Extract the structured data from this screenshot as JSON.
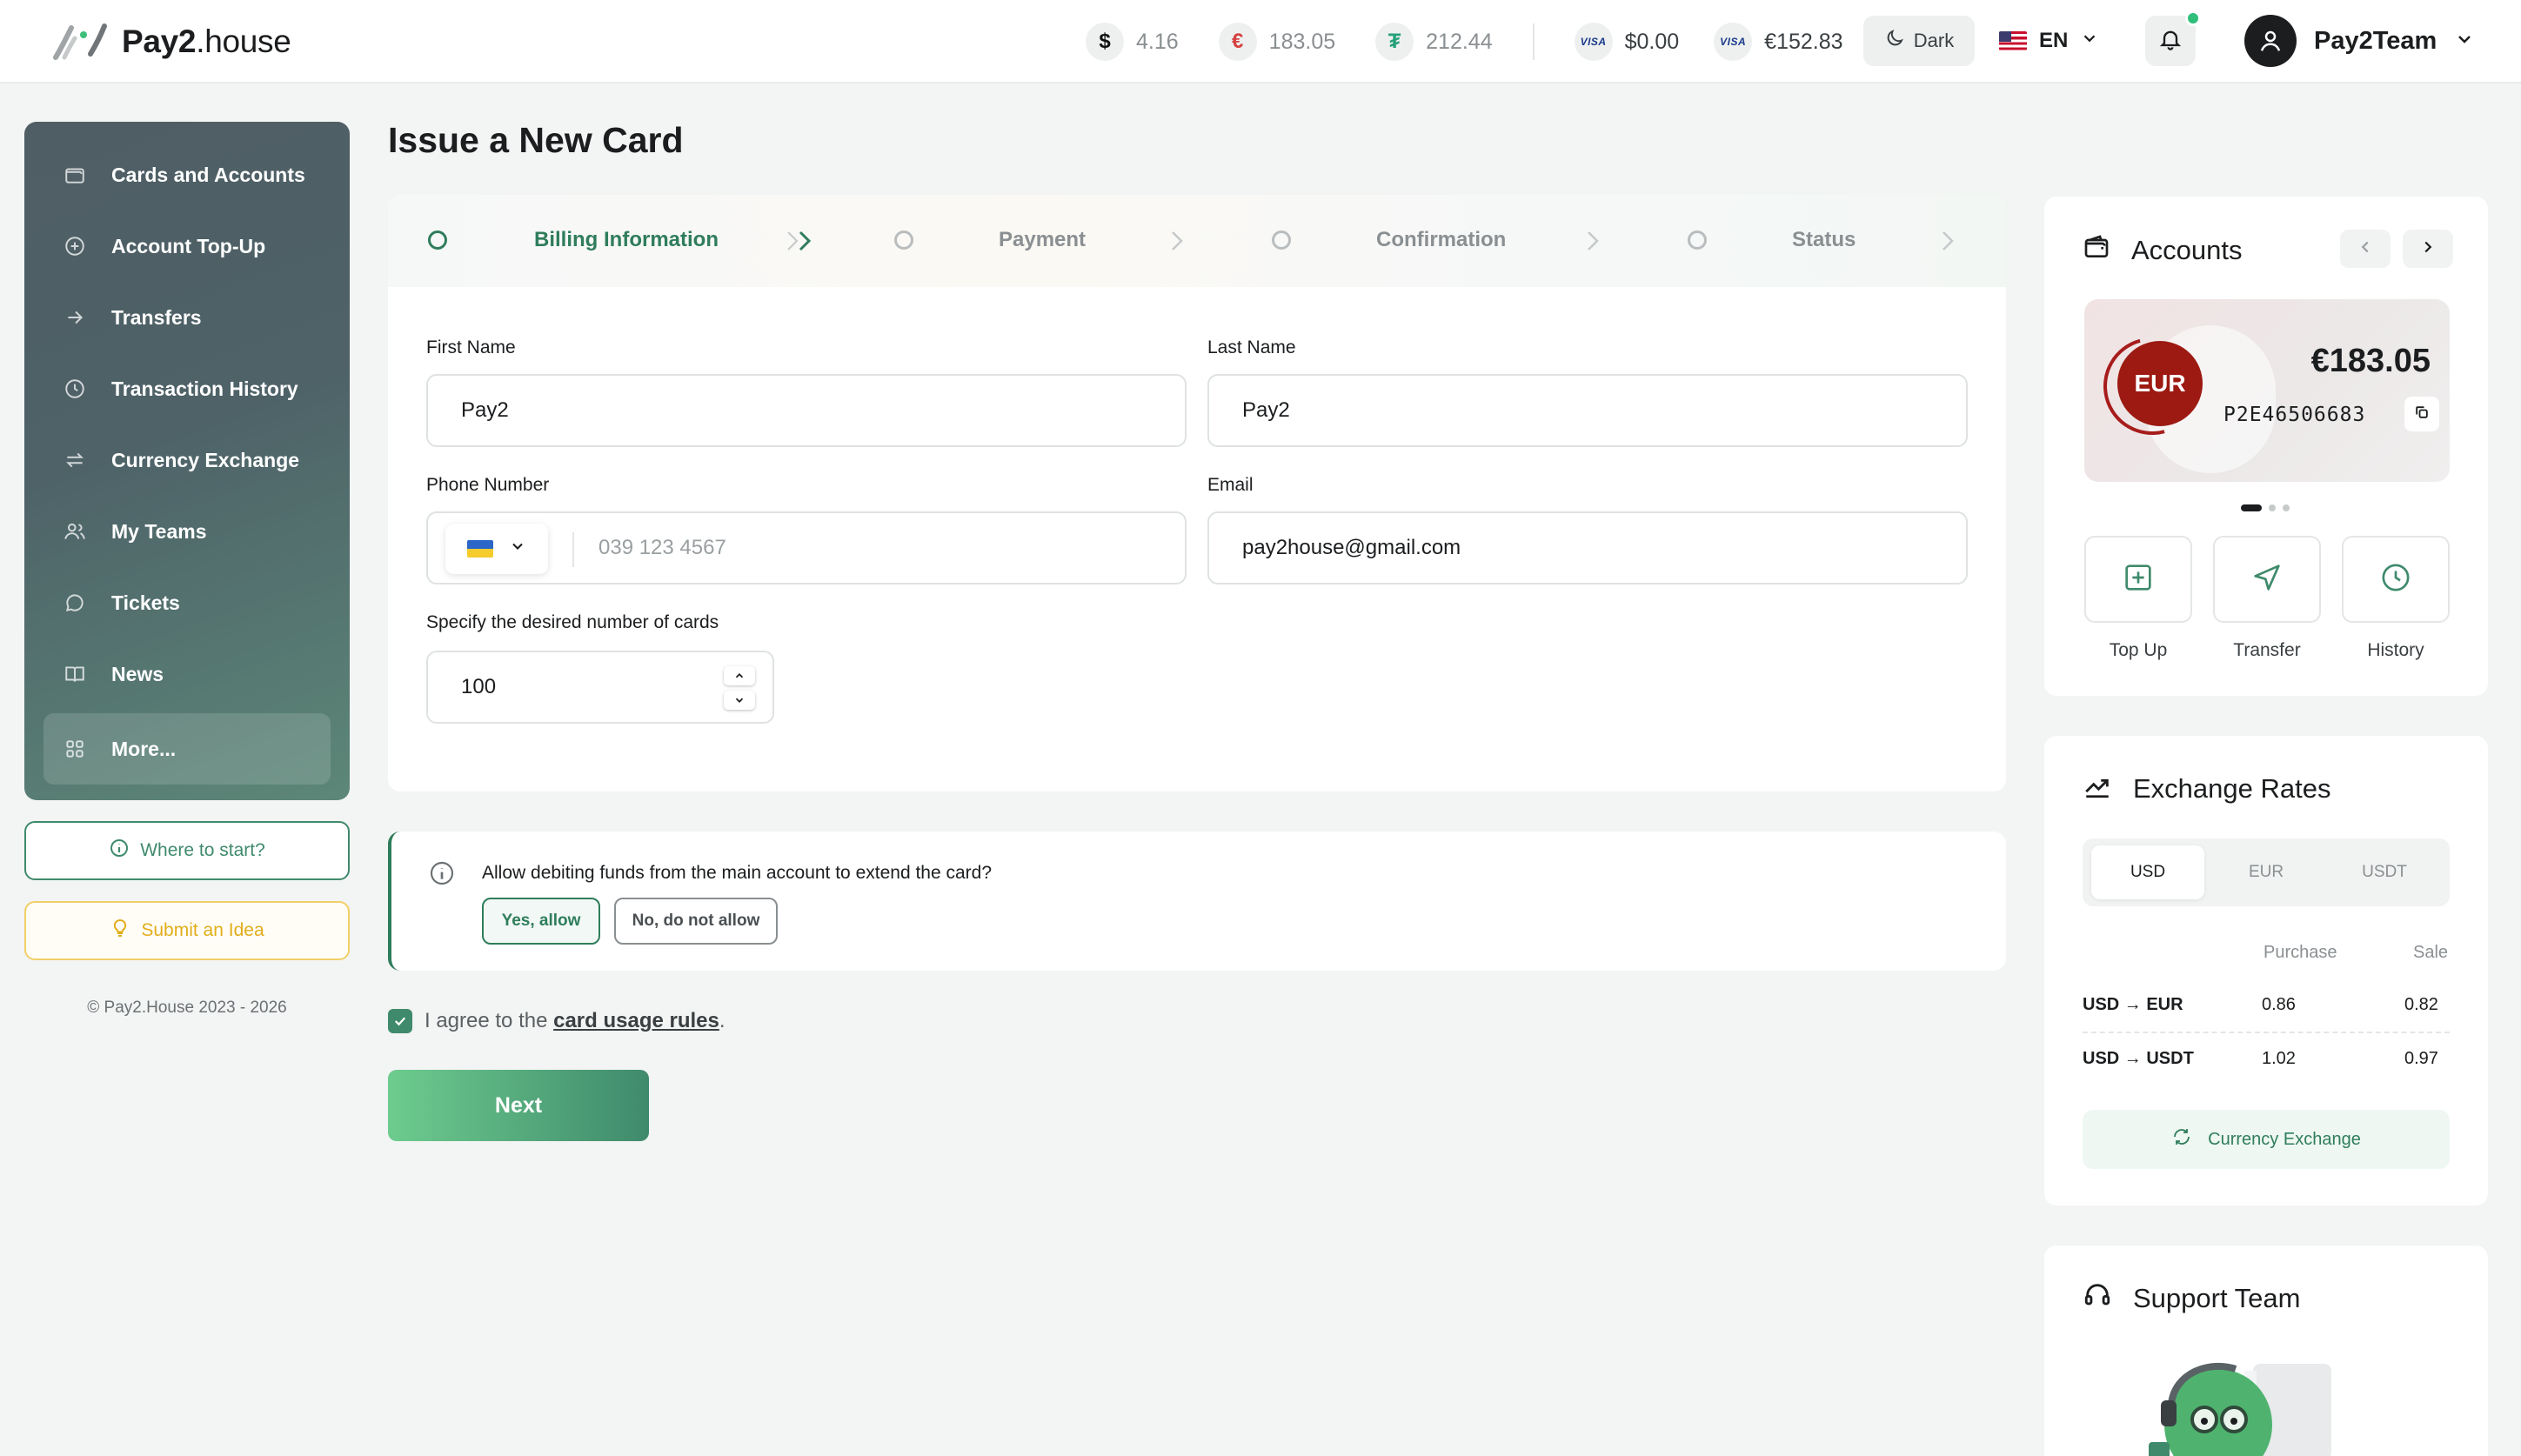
{
  "header": {
    "logo_bold": "Pay2",
    "logo_light": ".house",
    "balances": [
      {
        "icon": "dollar-icon",
        "symbol": "$",
        "value": "4.16"
      },
      {
        "icon": "euro-icon",
        "symbol": "€",
        "value": "183.05"
      },
      {
        "icon": "tether-icon",
        "symbol": "₮",
        "value": "212.44"
      }
    ],
    "cards": [
      {
        "icon": "visa-icon",
        "brand": "VISA",
        "value": "$0.00"
      },
      {
        "icon": "visa-icon",
        "brand": "VISA",
        "value": "€152.83"
      }
    ],
    "theme_label": "Dark",
    "language": "EN",
    "user_name": "Pay2Team"
  },
  "sidebar": {
    "items": [
      {
        "label": "Cards and Accounts",
        "icon": "wallet-icon"
      },
      {
        "label": "Account Top-Up",
        "icon": "plus-circle-icon"
      },
      {
        "label": "Transfers",
        "icon": "arrow-right-icon"
      },
      {
        "label": "Transaction History",
        "icon": "clock-icon"
      },
      {
        "label": "Currency Exchange",
        "icon": "exchange-icon"
      },
      {
        "label": "My Teams",
        "icon": "users-icon"
      },
      {
        "label": "Tickets",
        "icon": "chat-icon"
      },
      {
        "label": "News",
        "icon": "book-icon"
      },
      {
        "label": "More...",
        "icon": "grid-icon"
      }
    ],
    "where_to_start": "Where to start?",
    "submit_idea": "Submit an Idea",
    "copyright": "© Pay2.House 2023 - 2026"
  },
  "main": {
    "title": "Issue a New Card",
    "steps": [
      "Billing Information",
      "Payment",
      "Confirmation",
      "Status"
    ],
    "active_step": "Billing Information",
    "form": {
      "first_name_label": "First Name",
      "first_name_value": "Pay2",
      "last_name_label": "Last Name",
      "last_name_value": "Pay2",
      "phone_label": "Phone Number",
      "phone_placeholder": "039 123 4567",
      "email_label": "Email",
      "email_value": "pay2house@gmail.com",
      "cards_count_label": "Specify the desired number of cards",
      "cards_count_value": "100"
    },
    "allow": {
      "question": "Allow debiting funds from the main account to extend the card?",
      "yes": "Yes, allow",
      "no": "No, do not allow"
    },
    "agree_prefix": "I agree to the",
    "agree_link": "card usage rules",
    "agree_suffix": ".",
    "next_label": "Next"
  },
  "accounts": {
    "title": "Accounts",
    "currency": "EUR",
    "amount": "€183.05",
    "account_id": "P2E46506683",
    "actions": [
      "Top Up",
      "Transfer",
      "History"
    ]
  },
  "rates": {
    "title": "Exchange Rates",
    "tabs": [
      "USD",
      "EUR",
      "USDT"
    ],
    "active_tab": "USD",
    "col_purchase": "Purchase",
    "col_sale": "Sale",
    "rows": [
      {
        "pair": "USD → EUR",
        "purchase": "0.86",
        "sale": "0.82"
      },
      {
        "pair": "USD → USDT",
        "purchase": "1.02",
        "sale": "0.97"
      }
    ],
    "button": "Currency Exchange"
  },
  "support": {
    "title": "Support Team"
  },
  "colors": {
    "accent": "#2f7d5c",
    "eur_badge": "#9c1a12",
    "idea": "#e1ad1b",
    "sidebar": "#4f5e64"
  }
}
